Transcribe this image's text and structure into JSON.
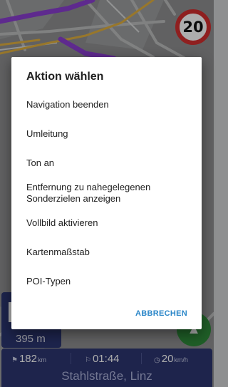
{
  "map": {
    "speed_limit": "20",
    "maneuver_distance": "395 m"
  },
  "bottom_panel": {
    "remaining_distance": {
      "icon": "route-icon",
      "value": "182",
      "unit": "km"
    },
    "arrival_time": {
      "icon": "flag-icon",
      "value": "01:44"
    },
    "current_speed": {
      "icon": "speedometer-icon",
      "value": "20",
      "unit": "km/h"
    },
    "street_name": "Stahlstraße, Linz"
  },
  "dialog": {
    "title": "Aktion wählen",
    "items": [
      "Navigation beenden",
      "Umleitung",
      "Ton an",
      "Entfernung zu nahegelegenen Sonderzielen anzeigen",
      "Vollbild aktivieren",
      "Kartenmaßstab",
      "POI-Typen"
    ],
    "cancel_label": "ABBRECHEN"
  },
  "colors": {
    "accent": "#2a86c8",
    "route": "#8b3fd1",
    "panel": "#2d3671",
    "speed_sign_border": "#d32f2f",
    "fab": "#2e8b3a"
  }
}
